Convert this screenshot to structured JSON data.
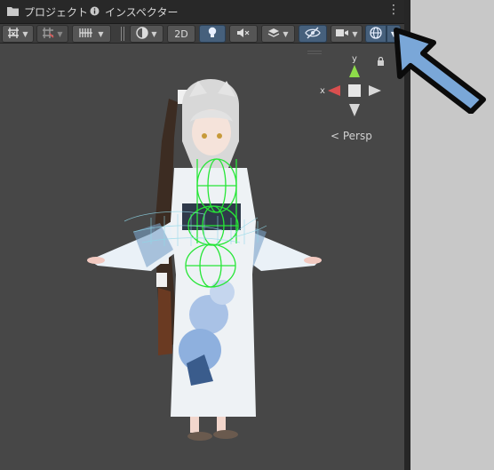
{
  "tabs": [
    {
      "label": "プロジェクト",
      "icon": "folder-icon"
    },
    {
      "label": "インスペクター",
      "icon": "info-icon"
    }
  ],
  "toolbar": {
    "mode_2d_label": "2D",
    "buttons": [
      "draw-mode",
      "view-options",
      "grid",
      "shaded",
      "2d",
      "lighting",
      "audio",
      "effects",
      "hidden-objects",
      "camera",
      "gizmos"
    ],
    "active": [
      "lighting",
      "hidden-objects",
      "gizmos"
    ]
  },
  "scene": {
    "projection_label": "< Persp",
    "gizmo": {
      "x_label": "x",
      "y_label": "y"
    }
  },
  "colors": {
    "accent_blue": "#7aa7d8",
    "active_button": "#46607c",
    "gizmo_x": "#d94f4f",
    "gizmo_y": "#8edc4a",
    "collider_green": "#27e637"
  }
}
